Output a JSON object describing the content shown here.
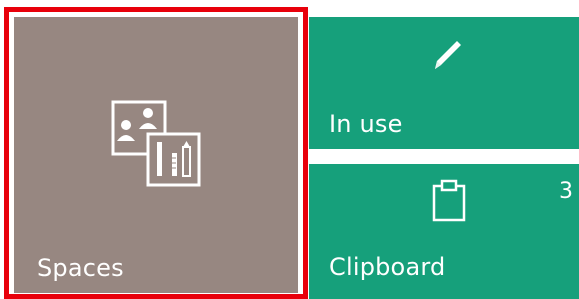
{
  "tiles": {
    "spaces": {
      "label": "Spaces",
      "icon": "spaces-icon",
      "color": "#978781"
    },
    "in_use": {
      "label": "In use",
      "icon": "pencil-icon",
      "color": "#16a07b"
    },
    "clipboard": {
      "label": "Clipboard",
      "icon": "clipboard-icon",
      "count": "3",
      "color": "#16a07b"
    }
  },
  "focus_color": "#e8000b"
}
